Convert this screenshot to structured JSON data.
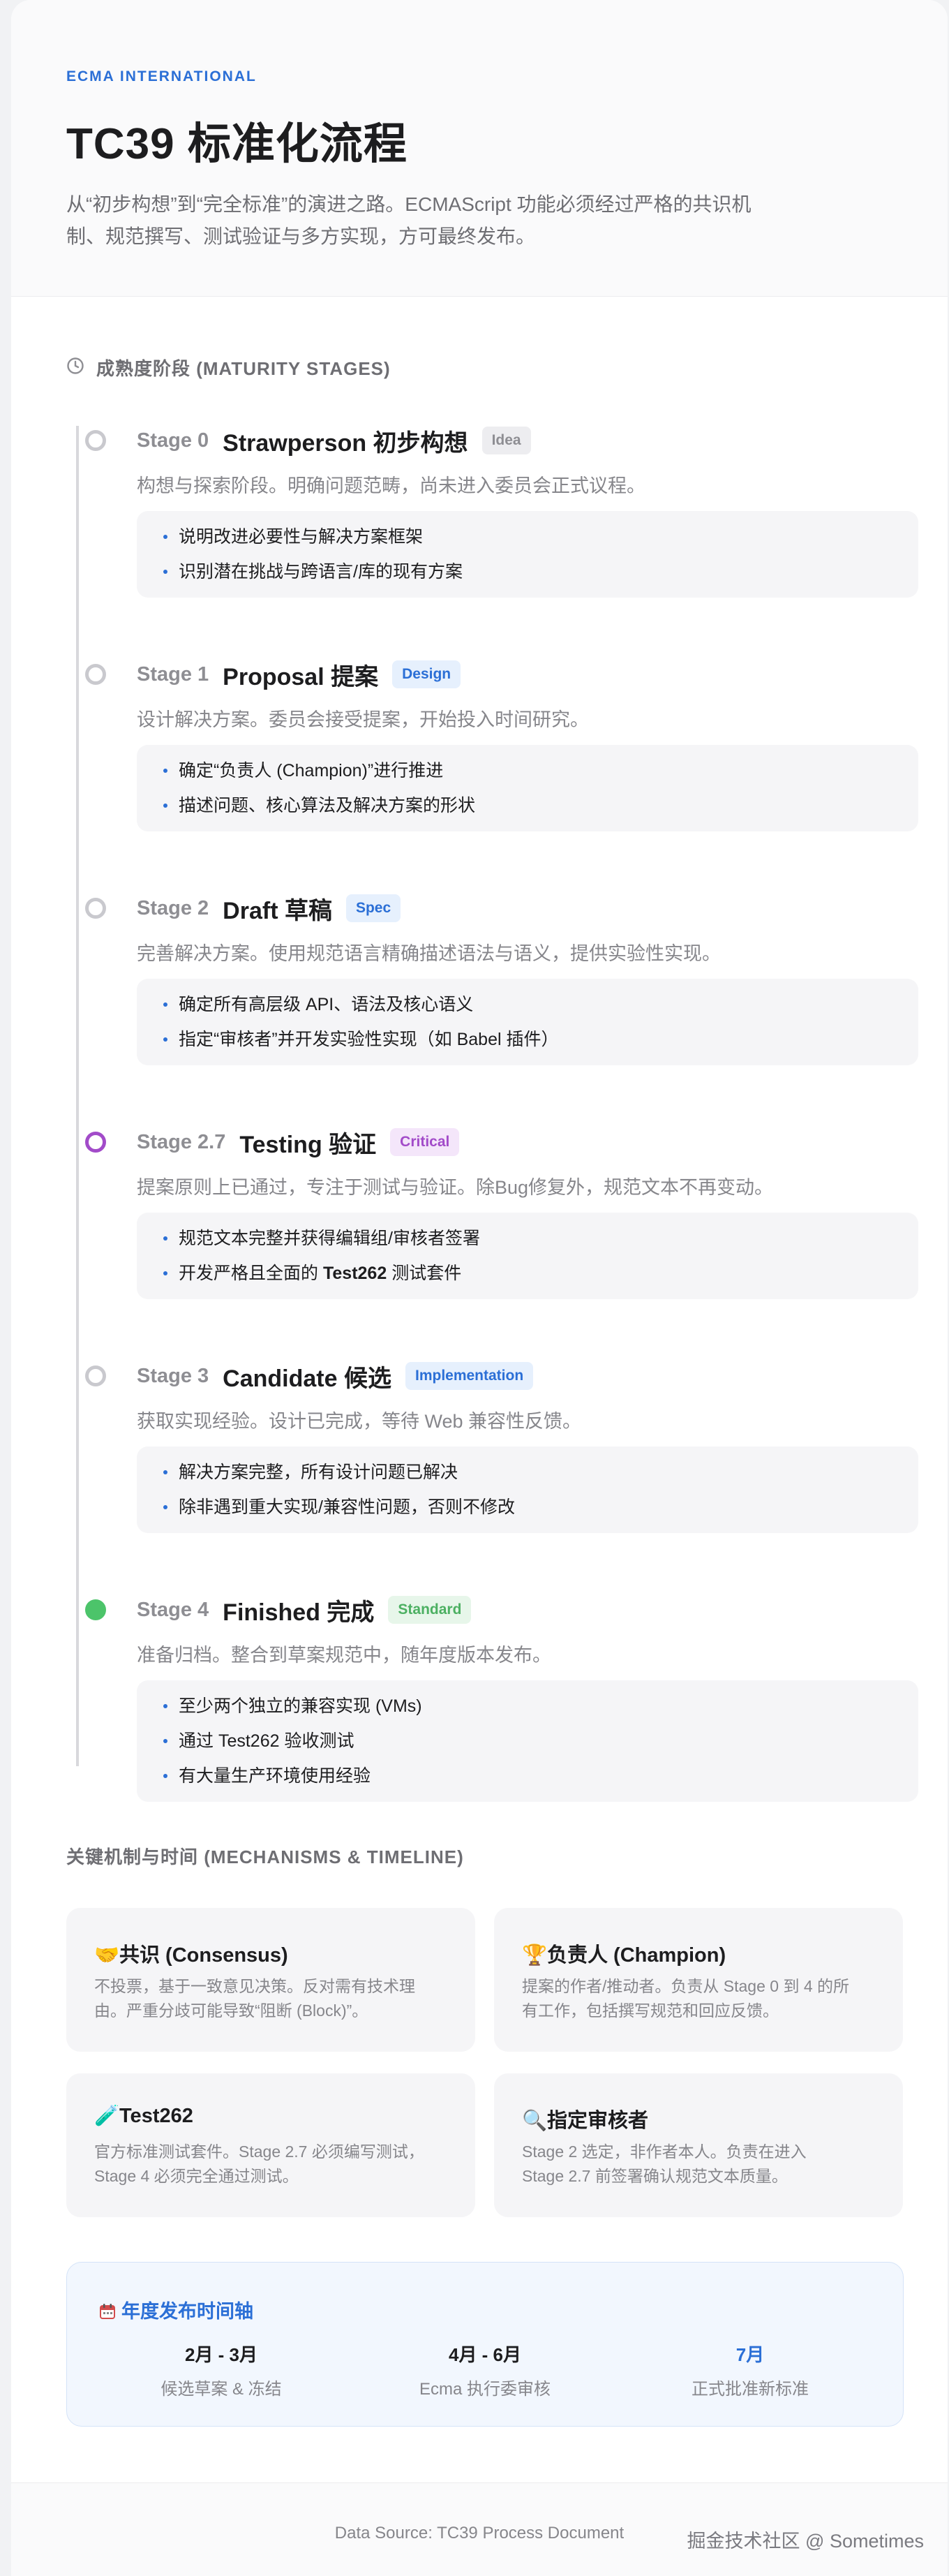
{
  "header": {
    "eyebrow": "ECMA INTERNATIONAL",
    "title": "TC39 标准化流程",
    "subtitle_line1": "从“初步构想”到“完全标准”的演进之路。ECMAScript 功能必须经过严格的共识机",
    "subtitle_line2": "制、规范撰写、测试验证与多方实现，方可最终发布。"
  },
  "maturity": {
    "section_title": "成熟度阶段 (MATURITY STAGES)",
    "icon": "clock-icon",
    "stages": [
      {
        "num": "Stage 0",
        "name": "Strawperson 初步构想",
        "tag": "Idea",
        "tag_color": "#8e8e93",
        "desc": "构想与探索阶段。明确问题范畴，尚未进入委员会正式议程。",
        "bullets": [
          "说明改进必要性与解决方案框架",
          "识别潜在挑战与跨语言/库的现有方案"
        ]
      },
      {
        "num": "Stage 1",
        "name": "Proposal 提案",
        "tag": "Design",
        "tag_color": "#2b6fd6",
        "desc": "设计解决方案。委员会接受提案，开始投入时间研究。",
        "bullets": [
          "确定“负责人 (Champion)”进行推进",
          "描述问题、核心算法及解决方案的形状"
        ]
      },
      {
        "num": "Stage 2",
        "name": "Draft 草稿",
        "tag": "Spec",
        "tag_color": "#2b6fd6",
        "desc": "完善解决方案。使用规范语言精确描述语法与语义，提供实验性实现。",
        "bullets": [
          "确定所有高层级 API、语法及核心语义",
          "指定“审核者”并开发实验性实现（如 Babel 插件）"
        ]
      },
      {
        "num": "Stage 2.7",
        "name": "Testing 验证",
        "tag": "Critical",
        "tag_color": "#a24bc9",
        "desc": "提案原则上已通过，专注于测试与验证。除Bug修复外，规范文本不再变动。",
        "bullets": [
          "规范文本完整并获得编辑组/审核者签署",
          "开发严格且全面的",
          "Test262",
          "测试套件"
        ]
      },
      {
        "num": "Stage 3",
        "name": "Candidate 候选",
        "tag": "Implementation",
        "tag_color": "#2b6fd6",
        "desc": "获取实现经验。设计已完成，等待 Web 兼容性反馈。",
        "bullets": [
          "解决方案完整，所有设计问题已解决",
          "除非遇到重大实现/兼容性问题，否则不修改"
        ]
      },
      {
        "num": "Stage 4",
        "name": "Finished 完成",
        "tag": "Standard",
        "tag_color": "#4cb062",
        "desc": "准备归档。整合到草案规范中，随年度版本发布。",
        "bullets": [
          "至少两个独立的兼容实现 (VMs)",
          "通过 Test262 验收测试",
          "有大量生产环境使用经验"
        ]
      }
    ]
  },
  "mechanisms": {
    "section_title": "关键机制与时间 (MECHANISMS & TIMELINE)",
    "cards": [
      {
        "emoji": "🤝",
        "icon": "handshake-icon",
        "title": "共识 (Consensus)",
        "desc_line1": "不投票，基于一致意见决策。反对需有技术理",
        "desc_line2": "由。严重分歧可能导致“阻断 (Block)”。"
      },
      {
        "emoji": "🏆",
        "icon": "trophy-icon",
        "title": "负责人 (Champion)",
        "desc_line1": "提案的作者/推动者。负责从 Stage 0 到 4 的所",
        "desc_line2": "有工作，包括撰写规范和回应反馈。"
      },
      {
        "emoji": "🧪",
        "icon": "test-tube-icon",
        "title": "Test262",
        "desc_line1": "官方标准测试套件。Stage 2.7 必须编写测试，",
        "desc_line2": "Stage 4 必须完全通过测试。"
      },
      {
        "emoji": "🔍",
        "icon": "magnifier-icon",
        "title": "指定审核者",
        "desc_line1": "Stage 2 选定，非作者本人。负责在进入",
        "desc_line2": "Stage 2.7 前签署确认规范文本质量。"
      }
    ]
  },
  "yearly": {
    "icon": "calendar-icon",
    "title": "年度发布时间轴",
    "columns": [
      {
        "date": "2月 - 3月",
        "label": "候选草案 & 冻结"
      },
      {
        "date": "4月 - 6月",
        "label": "Ecma 执行委审核"
      },
      {
        "date": "7月",
        "label": "正式批准新标准"
      }
    ]
  },
  "footer": {
    "text": "Data Source: TC39 Process Document",
    "watermark": "掘金技术社区 @ Sometimes"
  },
  "colors": {
    "accent": "#2b6fd6",
    "purple": "#a24bc9",
    "green": "#4cc46a",
    "muted": "#86868b"
  }
}
